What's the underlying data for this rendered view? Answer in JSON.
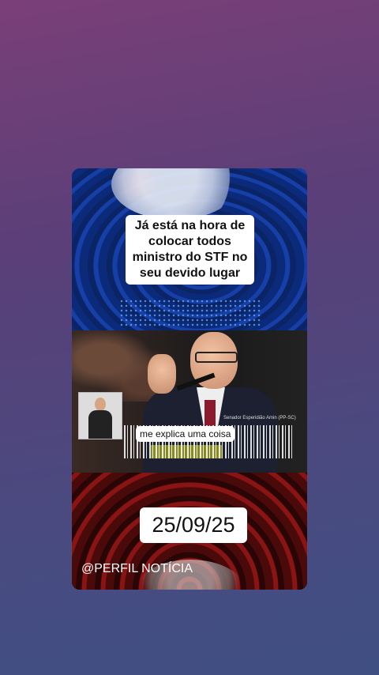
{
  "story": {
    "headline": "Já está na hora de colocar todos ministro do STF no seu devido lugar",
    "caption": "me explica uma coisa",
    "name_tag": "Senador Esperidião Amin (PP-SC)",
    "date": "25/09/25",
    "handle": "@PERFIL NOTÍCIA"
  }
}
